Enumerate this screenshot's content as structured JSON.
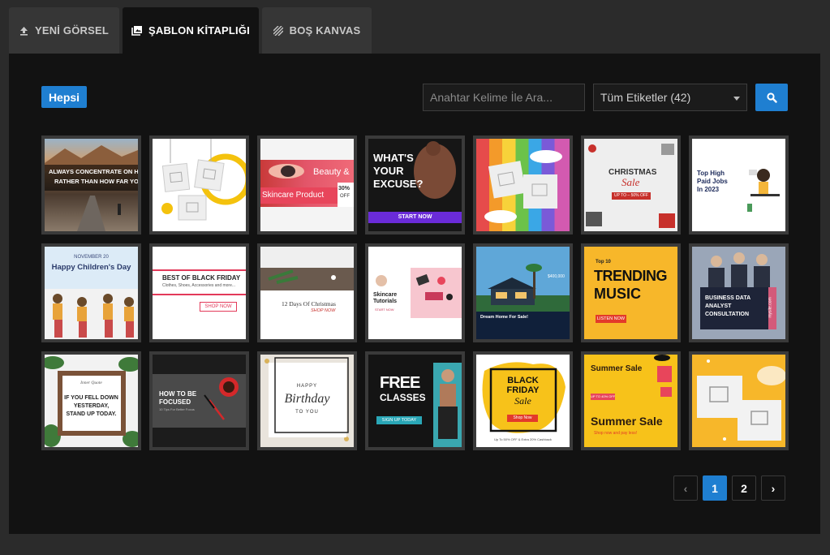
{
  "tabs": [
    {
      "label": "YENİ GÖRSEL",
      "icon": "upload-icon"
    },
    {
      "label": "ŞABLON KİTAPLIĞI",
      "icon": "library-icon"
    },
    {
      "label": "BOŞ KANVAS",
      "icon": "hatch-canvas-icon"
    }
  ],
  "filter": {
    "active_tag": "Hepsi"
  },
  "search": {
    "placeholder": "Anahtar Kelime İle Ara...",
    "tag_select": "Tüm Etiketler (42)"
  },
  "colors": {
    "accent": "#1f7fd1",
    "panel_bg": "#121212",
    "tab_bg": "#363636"
  },
  "templates": {
    "t1": {
      "line1": "ALWAYS CONCENTRATE ON HOW",
      "line2": "RATHER THAN HOW FAR YOU H"
    },
    "t3": {
      "beauty": "Beauty &",
      "skincare": "Skincare Product",
      "discount": "30%",
      "off": "OFF"
    },
    "t4": {
      "line1": "WHAT'S",
      "line2": "YOUR",
      "line3": "EXCUSE?",
      "cta": "START NOW"
    },
    "t6": {
      "title": "CHRISTMAS",
      "sale": "Sale",
      "badge": "UP TO – 50% OFF"
    },
    "t7": {
      "line1": "Top High",
      "line2": "Paid Jobs",
      "line3": "In 2023"
    },
    "t8": {
      "date": "NOVEMBER 20",
      "title": "Happy Children's Day"
    },
    "t9": {
      "title": "BEST OF BLACK FRIDAY",
      "sub": "Clothes, Shoes, Accessories and more...",
      "cta": "SHOP NOW"
    },
    "t10": {
      "title": "12 Days Of Christmas",
      "cta": "SHOP NOW"
    },
    "t11": {
      "line1": "Skincare",
      "line2": "Tutorials",
      "cta": "START NOW"
    },
    "t12": {
      "headline": "Dream Home For Sale!",
      "price": "$400,000"
    },
    "t13": {
      "top": "Top 10",
      "line1": "TRENDING",
      "line2": "MUSIC",
      "cta": "LISTEN NOW"
    },
    "t14": {
      "line1": "BUSINESS DATA",
      "line2": "ANALYST",
      "line3": "CONSULTATION",
      "site": "mysite.com"
    },
    "t15": {
      "quote": "Inner Quote",
      "line1": "IF YOU FELL DOWN",
      "line2": "YESTERDAY,",
      "line3": "STAND UP TODAY."
    },
    "t16": {
      "line1": "HOW TO BE",
      "line2": "FOCUSED",
      "sub": "10 Tips For Better Focus"
    },
    "t17": {
      "happy": "HAPPY",
      "birthday": "Birthday",
      "toyou": "TO YOU"
    },
    "t18": {
      "line1": "FREE",
      "line2": "CLASSES",
      "cta": "SIGN UP TODAY"
    },
    "t19": {
      "line1": "BLACK",
      "line2": "FRIDAY",
      "line3": "Sale",
      "cta": "Shop Now",
      "footer": "Up To 50% OFF & Extra 20% Cashback"
    },
    "t20": {
      "title1": "Summer Sale",
      "badge": "UP TO 40% OFF",
      "title2": "Summer Sale",
      "sub": "Shop now and pay less!"
    }
  },
  "pagination": {
    "prev": "‹",
    "pages": [
      "1",
      "2"
    ],
    "current": "1",
    "next": "›"
  }
}
